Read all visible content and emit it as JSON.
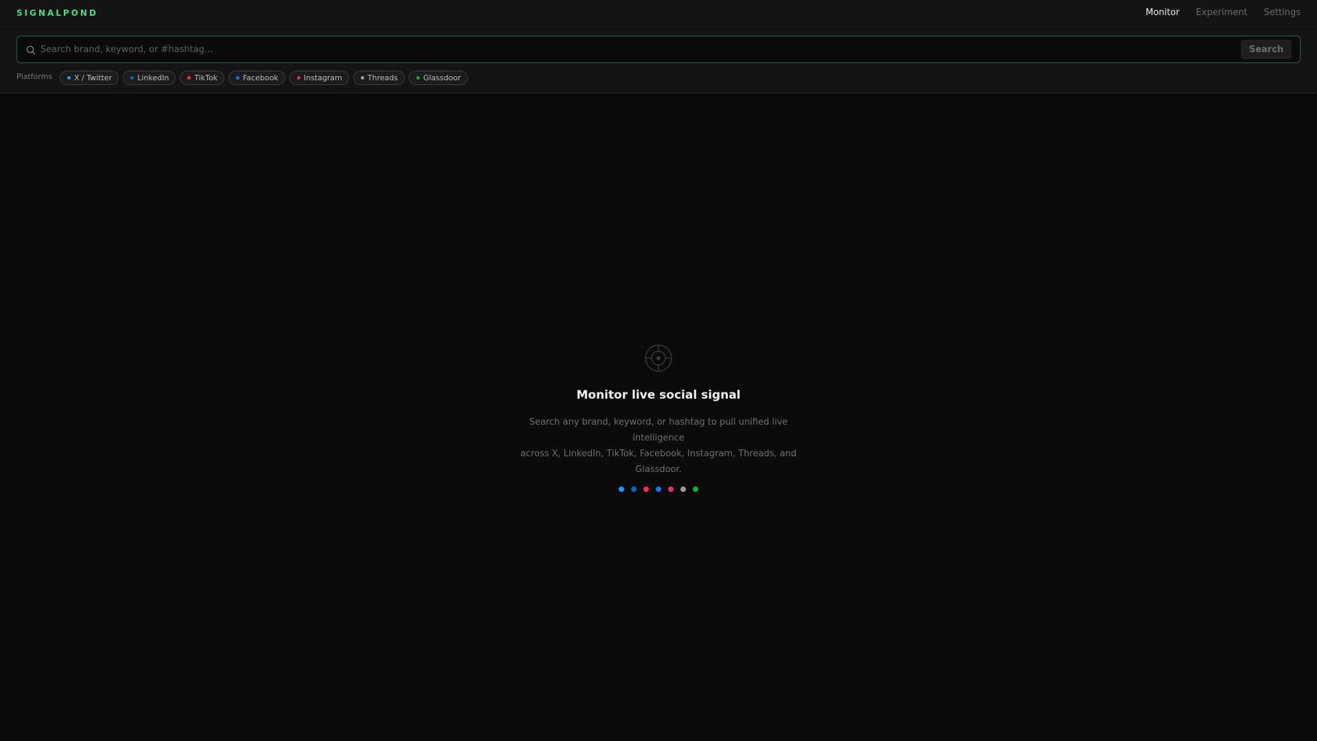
{
  "header": {
    "brand": "SIGNALPOND",
    "nav": [
      {
        "label": "Monitor",
        "active": true
      },
      {
        "label": "Experiment",
        "active": false
      },
      {
        "label": "Settings",
        "active": false
      }
    ]
  },
  "search": {
    "placeholder": "Search brand, keyword, or #hashtag...",
    "value": "",
    "button_label": "Search",
    "icon": "search-icon"
  },
  "platforms": {
    "label": "Platforms",
    "items": [
      {
        "label": "X / Twitter",
        "color": "#1d9bf0"
      },
      {
        "label": "LinkedIn",
        "color": "#0a66c2"
      },
      {
        "label": "TikTok",
        "color": "#fe2c55"
      },
      {
        "label": "Facebook",
        "color": "#1877f2"
      },
      {
        "label": "Instagram",
        "color": "#e1306c"
      },
      {
        "label": "Threads",
        "color": "#9a9a9a"
      },
      {
        "label": "Glassdoor",
        "color": "#0caa41"
      }
    ]
  },
  "empty_state": {
    "icon": "target-icon",
    "title": "Monitor live social signal",
    "description_line1": "Search any brand, keyword, or hashtag to pull unified live intelligence",
    "description_line2": "across X, LinkedIn, TikTok, Facebook, Instagram, Threads, and Glassdoor."
  },
  "colors": {
    "accent": "#4ade80",
    "background": "#0b0b0b",
    "panel": "#141414"
  }
}
